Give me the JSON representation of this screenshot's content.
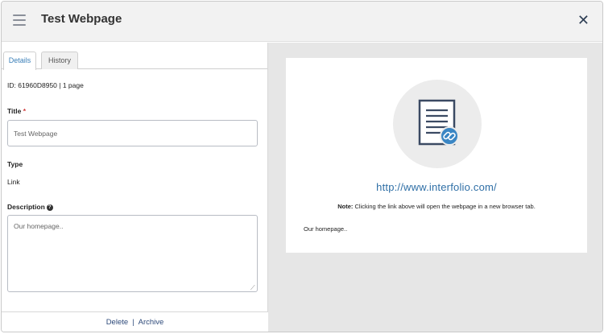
{
  "header": {
    "title": "Test Webpage",
    "close_label": "✕"
  },
  "tabs": [
    {
      "label": "Details",
      "active": true
    },
    {
      "label": "History",
      "active": false
    }
  ],
  "details": {
    "id_line": "ID: 61960D8950 | 1 page",
    "title_label": "Title",
    "required_mark": "*",
    "title_value": "Test Webpage",
    "type_label": "Type",
    "type_value": "Link",
    "description_label": "Description",
    "description_value": "Our homepage.."
  },
  "footer": {
    "delete_label": "Delete",
    "separator": "|",
    "archive_label": "Archive"
  },
  "preview": {
    "url": "http://www.interfolio.com/",
    "note_bold": "Note:",
    "note_text": " Clicking the link above will open the webpage in a new browser tab.",
    "description": "Our homepage.."
  },
  "colors": {
    "accent": "#2f6fa6",
    "link_badge": "#3a86c4",
    "header_bg": "#f2f2f2",
    "preview_bg": "#e6e6e6"
  },
  "icons": {
    "menu": "hamburger-menu-icon",
    "close": "close-icon",
    "document_link": "document-link-icon",
    "help": "question-circle-icon"
  }
}
